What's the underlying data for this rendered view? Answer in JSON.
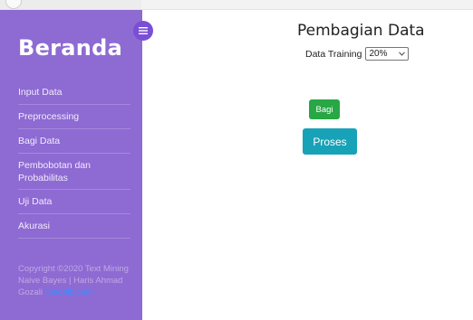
{
  "sidebar": {
    "brand": "Beranda",
    "items": [
      {
        "label": "Input Data"
      },
      {
        "label": "Preprocessing"
      },
      {
        "label": "Bagi Data"
      },
      {
        "label": "Pembobotan dan Probabilitas"
      },
      {
        "label": "Uji Data"
      },
      {
        "label": "Akurasi"
      }
    ],
    "copyright": {
      "text": "Copyright ©2020 Text Mining Naive Bayes | Haris Ahmad Gozali",
      "link": "Colorlib.com"
    }
  },
  "toggle_icon": "hamburger-menu-icon",
  "main": {
    "title": "Pembagian Data",
    "training_label": "Data Training",
    "training_select": {
      "value": "20%"
    },
    "bagi_label": "Bagi",
    "proses_label": "Proses"
  },
  "colors": {
    "sidebar_bg": "#8e6ad3",
    "toggle_bg": "#7a4fd6",
    "bagi_btn": "#28a745",
    "proses_btn": "#17a2b8",
    "link": "#3d8bff"
  }
}
